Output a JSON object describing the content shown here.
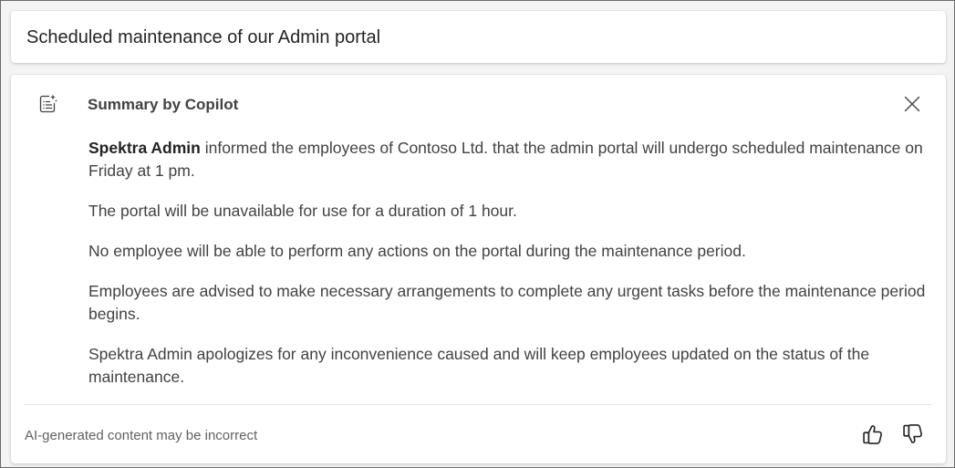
{
  "header": {
    "title": "Scheduled maintenance of our Admin portal"
  },
  "summary": {
    "heading": "Summary by Copilot",
    "icon": "copilot-summary-icon",
    "close_icon": "close-icon",
    "paragraphs": [
      {
        "bold": "Spektra Admin",
        "text": " informed the employees of Contoso Ltd. that the admin portal will undergo scheduled maintenance on Friday at 1 pm."
      },
      {
        "text": "The portal will be unavailable for use for a duration of 1 hour."
      },
      {
        "text": "No employee will be able to perform any actions on the portal during the maintenance period."
      },
      {
        "text": "Employees are advised to make necessary arrangements to complete any urgent tasks before the maintenance period begins."
      },
      {
        "text": "Spektra Admin apologizes for any inconvenience caused and will keep employees updated on the status of the maintenance."
      }
    ]
  },
  "footer": {
    "disclaimer": "AI-generated content may be incorrect",
    "thumbs_up_icon": "thumbs-up-icon",
    "thumbs_down_icon": "thumbs-down-icon"
  },
  "colors": {
    "background": "#f3f3f3",
    "card": "#ffffff",
    "text_primary": "#242424",
    "text_secondary": "#424242",
    "text_muted": "#616161"
  }
}
